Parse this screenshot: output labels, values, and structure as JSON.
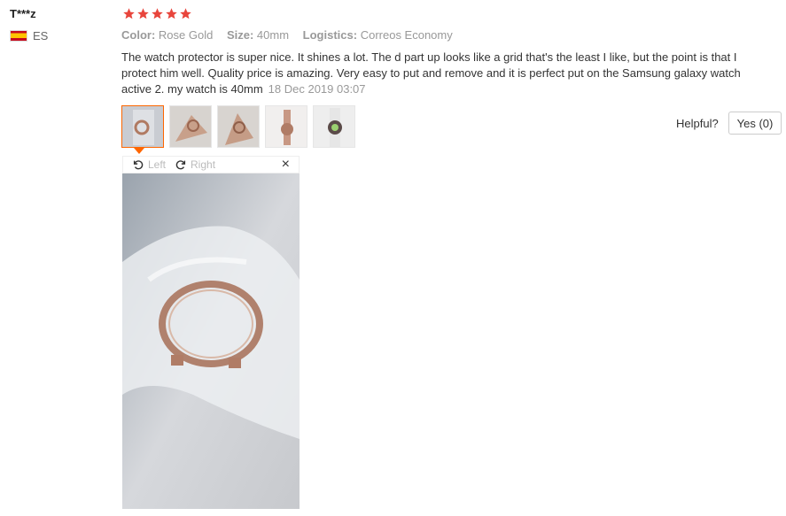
{
  "review": {
    "user": "T***z",
    "country": "ES",
    "rating": 5,
    "attributes": [
      {
        "key": "Color:",
        "value": "Rose Gold"
      },
      {
        "key": "Size:",
        "value": "40mm"
      },
      {
        "key": "Logistics:",
        "value": "Correos Economy"
      }
    ],
    "text": "The watch protector is super nice. It shines a lot. The d part up looks like a grid that's the least I like, but the point is that I protect him well. Quality price is amazing. Very easy to put and remove and it is perfect put on the Samsung galaxy watch active 2. my watch is 40mm",
    "date": "18 Dec 2019 03:07"
  },
  "viewer": {
    "left_label": "Left",
    "right_label": "Right",
    "close_label": "×"
  },
  "helpful": {
    "label": "Helpful?",
    "yes_label": "Yes (0)"
  },
  "colors": {
    "star": "#ee4d2d",
    "accent": "#ff6600"
  }
}
